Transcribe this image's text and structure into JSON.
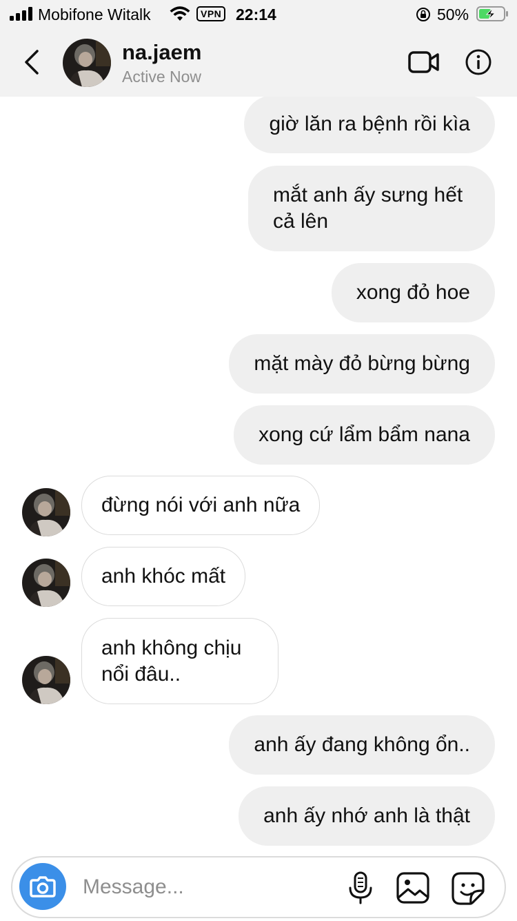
{
  "status_bar": {
    "carrier": "Mobifone Witalk",
    "vpn": "VPN",
    "time": "22:14",
    "battery_percent": "50%",
    "battery_level": 0.5,
    "battery_color": "#4cd964"
  },
  "header": {
    "username": "na.jaem",
    "status": "Active Now"
  },
  "messages": [
    {
      "side": "sent",
      "text": "giờ lăn ra bệnh rồi kìa"
    },
    {
      "side": "sent",
      "text": "mắt anh ấy sưng hết cả lên"
    },
    {
      "side": "sent",
      "text": "xong đỏ hoe"
    },
    {
      "side": "sent",
      "text": "mặt mày đỏ bừng bừng"
    },
    {
      "side": "sent",
      "text": "xong cứ lẩm bẩm nana"
    },
    {
      "side": "received",
      "text": "đừng nói với anh nữa"
    },
    {
      "side": "received",
      "text": "anh khóc mất"
    },
    {
      "side": "received",
      "text": "anh không chịu nổi đâu.."
    },
    {
      "side": "sent",
      "text": "anh ấy đang không ổn.."
    },
    {
      "side": "sent",
      "text": "anh ấy nhớ anh là thật"
    }
  ],
  "composer": {
    "placeholder": "Message...",
    "camera_color": "#3b8fe8",
    "icons": [
      "camera-icon",
      "microphone-icon",
      "image-gallery-icon",
      "sticker-icon"
    ]
  },
  "icons": {
    "back": "chevron-left-icon",
    "video": "video-camera-icon",
    "info": "info-icon"
  }
}
